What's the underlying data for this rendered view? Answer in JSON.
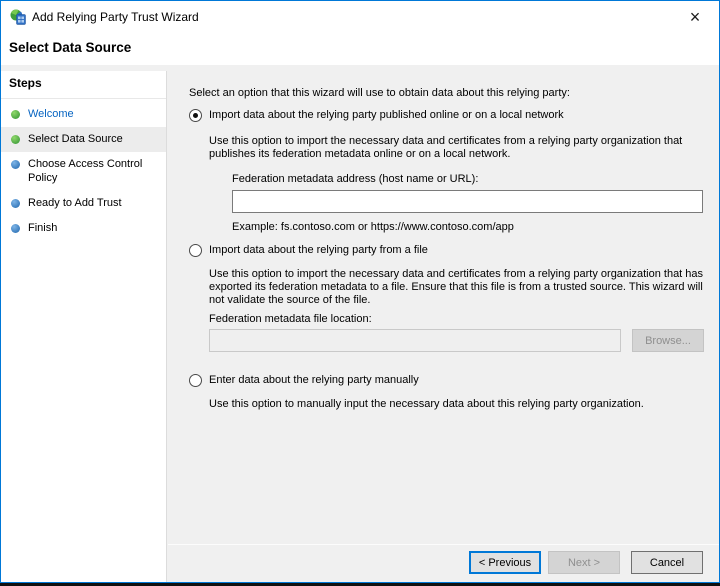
{
  "window": {
    "title": "Add Relying Party Trust Wizard",
    "close_glyph": "×"
  },
  "header": {
    "title": "Select Data Source"
  },
  "sidebar": {
    "heading": "Steps",
    "items": [
      {
        "label": "Welcome",
        "state": "done",
        "current": false,
        "link": true
      },
      {
        "label": "Select Data Source",
        "state": "done",
        "current": true,
        "link": false
      },
      {
        "label": "Choose Access Control Policy",
        "state": "todo",
        "current": false,
        "link": false
      },
      {
        "label": "Ready to Add Trust",
        "state": "todo",
        "current": false,
        "link": false
      },
      {
        "label": "Finish",
        "state": "todo",
        "current": false,
        "link": false
      }
    ]
  },
  "content": {
    "intro": "Select an option that this wizard will use to obtain data about this relying party:",
    "options": [
      {
        "label": "Import data about the relying party published online or on a local network",
        "selected": true,
        "description": "Use this option to import the necessary data and certificates from a relying party organization that publishes its federation metadata online or on a local network.",
        "field_label": "Federation metadata address (host name or URL):",
        "field_value": "",
        "example": "Example: fs.contoso.com or https://www.contoso.com/app"
      },
      {
        "label": "Import data about the relying party from a file",
        "selected": false,
        "description": "Use this option to import the necessary data and certificates from a relying party organization that has exported its federation metadata to a file. Ensure that this file is from a trusted source.  This wizard will not validate the source of the file.",
        "field_label": "Federation metadata file location:",
        "field_value": "",
        "browse_label": "Browse...",
        "enabled": false
      },
      {
        "label": "Enter data about the relying party manually",
        "selected": false,
        "description": "Use this option to manually input the necessary data about this relying party organization."
      }
    ]
  },
  "footer": {
    "previous_label": "< Previous",
    "next_label": "Next >",
    "next_enabled": false,
    "cancel_label": "Cancel"
  },
  "colors": {
    "accent": "#0078d7",
    "step_done": "#2f9232",
    "step_upcoming": "#1f66ad",
    "link": "#0563c1",
    "content_bg": "#f0f0f0"
  }
}
